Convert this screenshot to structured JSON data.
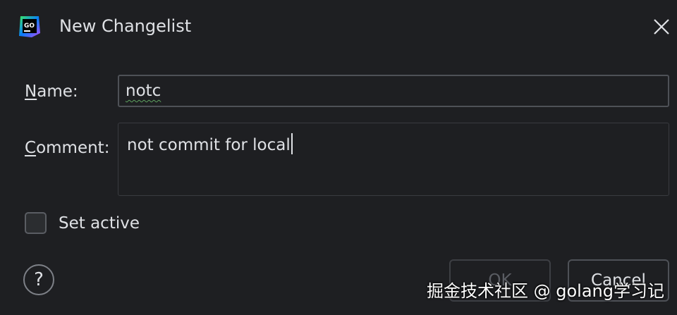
{
  "window": {
    "title": "New Changelist",
    "app_icon": "goland-logo",
    "app_icon_text": "GO",
    "close_icon": "close-icon"
  },
  "form": {
    "name_label": "Name:",
    "name_value": "notc",
    "comment_label": "Comment:",
    "comment_value": "not commit for local",
    "set_active_label": "Set active",
    "set_active_checked": false
  },
  "footer": {
    "help_icon": "help-icon",
    "help_symbol": "?",
    "ok_label": "OK",
    "ok_enabled": false,
    "cancel_label": "Cancel"
  },
  "watermark": "掘金技术社区 @ golang学习记",
  "colors": {
    "background": "#1e1f22",
    "text": "#dfe1e5",
    "border": "#4e5157",
    "spellcheck": "#5fa35f"
  }
}
